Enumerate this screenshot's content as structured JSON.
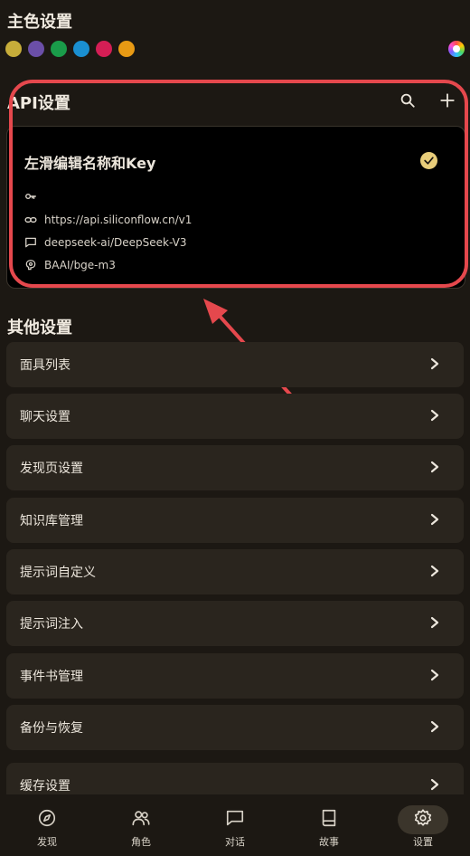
{
  "theme": {
    "title": "主色设置",
    "swatches": [
      "#c7ad3a",
      "#6b4fa8",
      "#1a9c4a",
      "#1a8fd1",
      "#d41e55",
      "#e89a14"
    ],
    "palette_icon": "palette-icon"
  },
  "api": {
    "title": "API设置",
    "card": {
      "title": "左滑编辑名称和Key",
      "key_value": "",
      "url": "https://api.siliconflow.cn/v1",
      "chat_model": "deepseek-ai/DeepSeek-V3",
      "embedding_model": "BAAI/bge-m3"
    }
  },
  "other": {
    "title": "其他设置",
    "items": [
      {
        "label": "面具列表"
      },
      {
        "label": "聊天设置"
      },
      {
        "label": "发现页设置"
      },
      {
        "label": "知识库管理"
      },
      {
        "label": "提示词自定义"
      },
      {
        "label": "提示词注入"
      },
      {
        "label": "事件书管理"
      },
      {
        "label": "备份与恢复"
      },
      {
        "label": "缓存设置"
      }
    ]
  },
  "nav": {
    "items": [
      {
        "label": "发现",
        "icon": "compass-icon"
      },
      {
        "label": "角色",
        "icon": "people-icon"
      },
      {
        "label": "对话",
        "icon": "chat-icon"
      },
      {
        "label": "故事",
        "icon": "book-icon"
      },
      {
        "label": "设置",
        "icon": "gear-icon"
      }
    ],
    "active_index": 4
  },
  "colors": {
    "accent": "#e8cd7a",
    "highlight": "#e5484d",
    "background": "#1c1813"
  }
}
